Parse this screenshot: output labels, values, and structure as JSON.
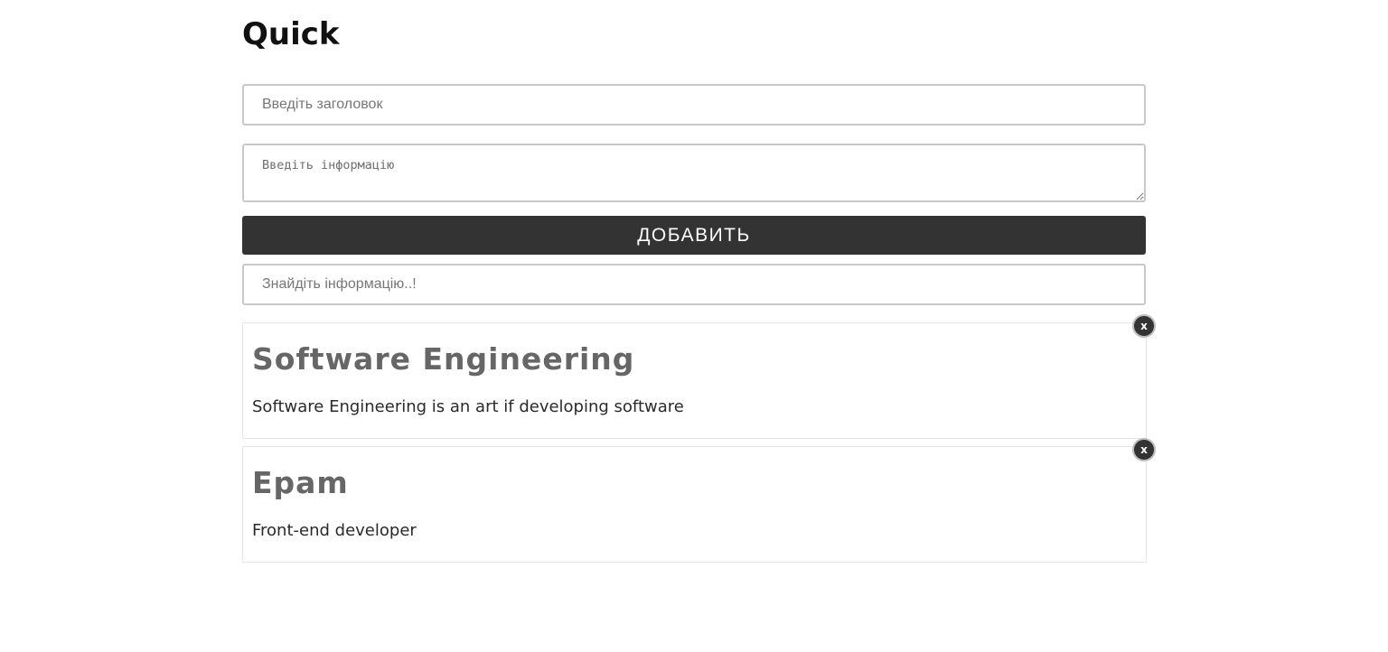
{
  "app": {
    "title": "Quick"
  },
  "form": {
    "title_placeholder": "Введіть заголовок",
    "title_value": "",
    "info_placeholder": "Введіть інформацію",
    "info_value": "",
    "add_label": "ДОБАВИТЬ"
  },
  "search": {
    "placeholder": "Знайдіть інформацію..!",
    "value": ""
  },
  "notes": [
    {
      "title": "Software Engineering",
      "body": "Software Engineering is an art if developing software",
      "delete_label": "x"
    },
    {
      "title": "Epam",
      "body": "Front-end developer",
      "delete_label": "x"
    }
  ],
  "colors": {
    "button_bg": "#333333",
    "button_text": "#ffffff",
    "card_title": "#666666",
    "input_border": "#c9c9c9"
  }
}
